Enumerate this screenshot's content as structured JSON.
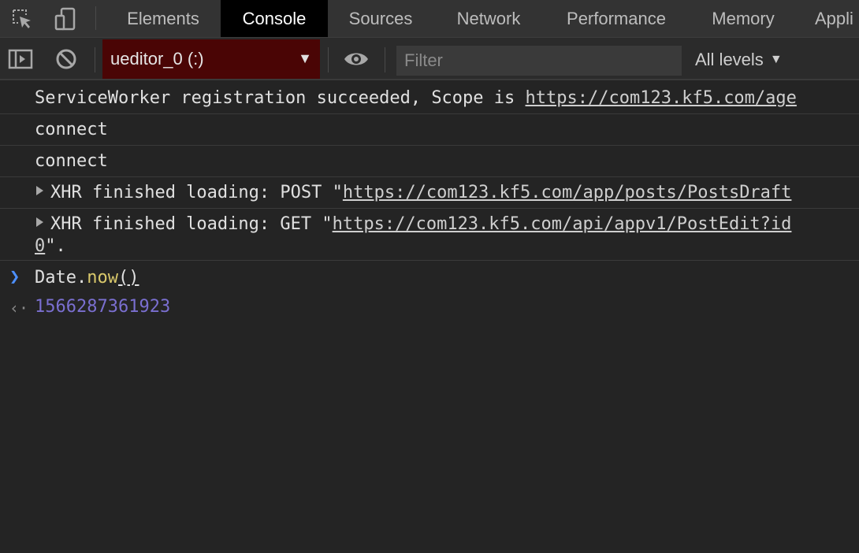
{
  "tabs": [
    {
      "label": "Elements",
      "active": false
    },
    {
      "label": "Console",
      "active": true
    },
    {
      "label": "Sources",
      "active": false
    },
    {
      "label": "Network",
      "active": false
    },
    {
      "label": "Performance",
      "active": false
    },
    {
      "label": "Memory",
      "active": false
    },
    {
      "label": "Appli",
      "active": false
    }
  ],
  "toolbar": {
    "context": "ueditor_0 (:)",
    "filter_placeholder": "Filter",
    "levels": "All levels"
  },
  "messages": {
    "sw_prefix": "ServiceWorker registration succeeded, Scope is ",
    "sw_link": "https://com123.kf5.com/age",
    "connect1": "connect",
    "connect2": "connect",
    "xhr1_prefix": "XHR finished loading: POST \"",
    "xhr1_link": "https://com123.kf5.com/app/posts/PostsDraft",
    "xhr2_prefix": "XHR finished loading: GET \"",
    "xhr2_link": "https://com123.kf5.com/api/appv1/PostEdit?id",
    "xhr2_cont_link": "0",
    "xhr2_cont_suffix": "\"."
  },
  "command": {
    "object": "Date.",
    "method": "now",
    "parens": "()"
  },
  "result": "1566287361923",
  "colors": {
    "active_tab_bg": "#000000",
    "context_bg": "#4a0505",
    "prompt_arrow": "#4d90fe",
    "function_name": "#d9c86b",
    "number_result": "#7a6fd0"
  }
}
